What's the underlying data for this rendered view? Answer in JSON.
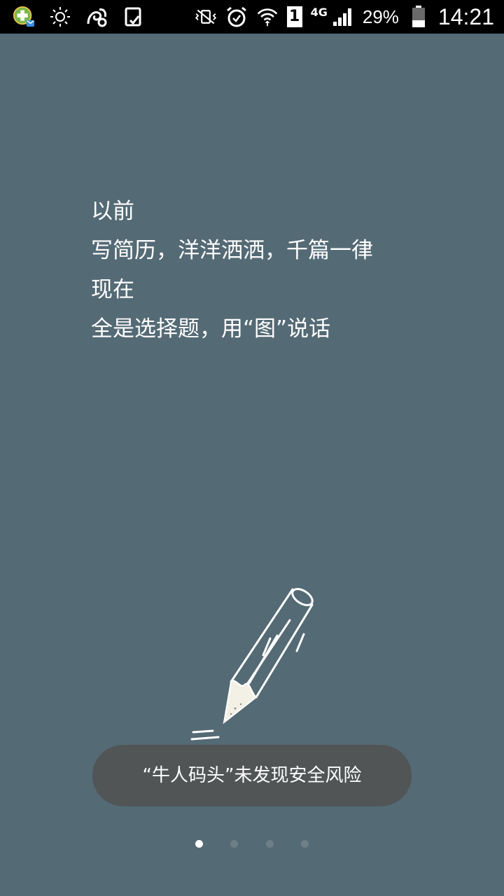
{
  "status_bar": {
    "left_icons": [
      "app-notification-icon",
      "brightness-icon",
      "uc-browser-icon",
      "clipboard-check-icon"
    ],
    "right_icons": [
      "vibrate-icon",
      "alarm-icon",
      "wifi-icon",
      "sim-1-icon",
      "signal-icon",
      "battery-icon"
    ],
    "sim_label": "1",
    "network_type": "4G",
    "battery_percent": "29%",
    "time": "14:21"
  },
  "intro": {
    "line1": "以前",
    "line2": "写简历，洋洋洒洒，千篇一律",
    "line3": "现在",
    "line4": "全是选择题，用“图”说话"
  },
  "toast": {
    "message": "“牛人码头”未发现安全风险"
  },
  "pager": {
    "total": 4,
    "active_index": 0
  },
  "colors": {
    "background": "#546a75",
    "status_bar": "#000000",
    "toast": "#515556",
    "text": "#ffffff"
  }
}
